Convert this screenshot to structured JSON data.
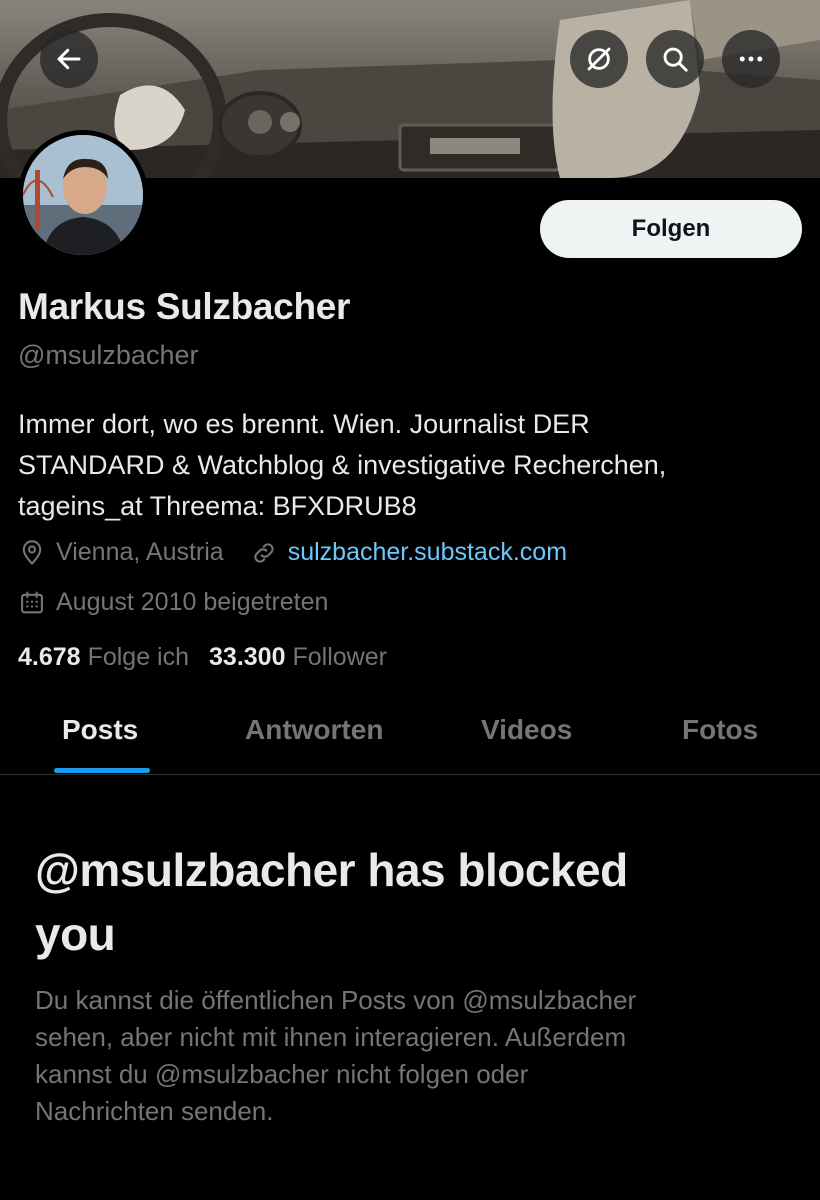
{
  "header": {
    "back_icon": "arrow-left-icon",
    "grok_icon": "slash-circle-icon",
    "search_icon": "search-icon",
    "more_icon": "more-horizontal-icon"
  },
  "profile": {
    "name": "Markus Sulzbacher",
    "handle": "@msulzbacher",
    "follow_label": "Folgen",
    "bio_lines": [
      "Immer dort, wo es brennt. Wien. Journalist DER",
      "STANDARD & Watchblog & investigative Recherchen,",
      "tageins_at Threema: BFXDRUB8"
    ],
    "location": "Vienna, Austria",
    "website": "sulzbacher.substack.com",
    "joined": "August 2010 beigetreten",
    "following_count": "4.678",
    "following_label": "Folge ich",
    "followers_count": "33.300",
    "followers_label": "Follower"
  },
  "tabs": [
    {
      "label": "Posts"
    },
    {
      "label": "Antworten"
    },
    {
      "label": "Videos"
    },
    {
      "label": "Fotos"
    }
  ],
  "blocked": {
    "title_line1": "@msulzbacher has blocked",
    "title_line2": "you",
    "text_lines": [
      "Du kannst die öffentlichen Posts von @msulzbacher",
      "sehen, aber nicht mit ihnen interagieren. Außerdem",
      "kannst du @msulzbacher nicht folgen oder",
      "Nachrichten senden."
    ]
  },
  "colors": {
    "background": "#000000",
    "accent": "#1d9bf0",
    "link": "#6bc9fb",
    "muted": "#71767b"
  }
}
